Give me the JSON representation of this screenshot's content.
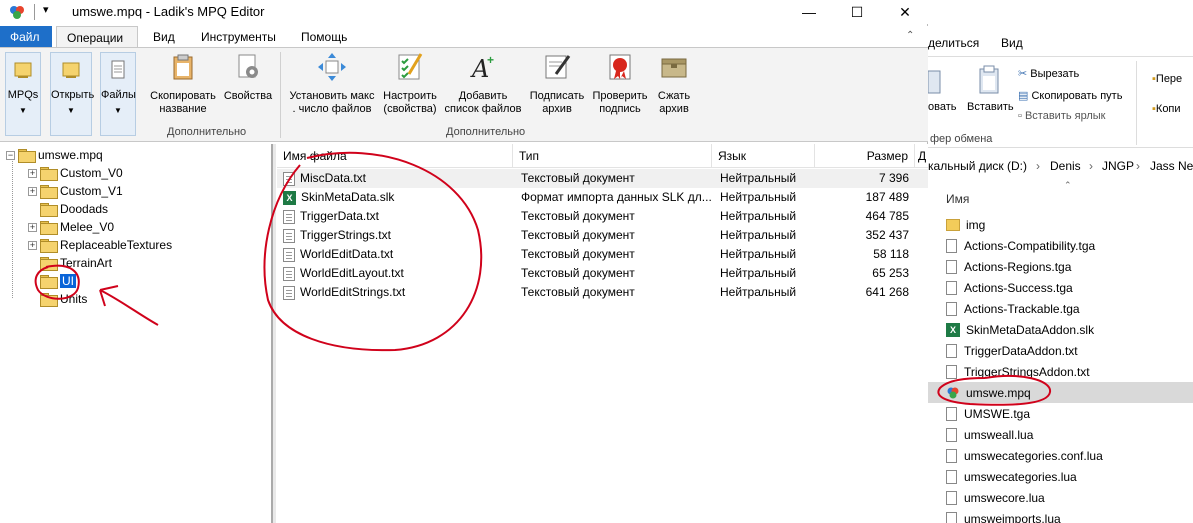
{
  "window": {
    "title": "umswe.mpq - Ladik's MPQ Editor",
    "qat_arrow": "▾",
    "minimize": "—",
    "maximize": "☐",
    "close": "✕"
  },
  "ribbon": {
    "tabs": [
      "Файл",
      "Операции",
      "Вид",
      "Инструменты",
      "Помощь"
    ],
    "buttons": {
      "mpqs": "MPQs",
      "open": "Открыть",
      "files": "Файлы",
      "copy_name": [
        "Скопировать",
        "название"
      ],
      "properties": "Свойства",
      "set_max": [
        "Установить макс",
        ". число файлов"
      ],
      "settings": [
        "Настроить",
        "(свойства)"
      ],
      "add_list": [
        "Добавить",
        "список файлов"
      ],
      "sign": [
        "Подписать",
        "архив"
      ],
      "verify": [
        "Проверить",
        "подпись"
      ],
      "compress": [
        "Сжать",
        "архив"
      ]
    },
    "groups": [
      "Дополнительно",
      "Дополнительно"
    ],
    "collapse": "⌃"
  },
  "tree": {
    "root": "umswe.mpq",
    "items": [
      {
        "label": "Custom_V0",
        "expandable": true
      },
      {
        "label": "Custom_V1",
        "expandable": true
      },
      {
        "label": "Doodads",
        "expandable": false
      },
      {
        "label": "Melee_V0",
        "expandable": true
      },
      {
        "label": "ReplaceableTextures",
        "expandable": true
      },
      {
        "label": "TerrainArt",
        "expandable": false
      },
      {
        "label": "UI",
        "expandable": false,
        "selected": true
      },
      {
        "label": "Units",
        "expandable": false
      }
    ]
  },
  "list": {
    "columns": [
      "Имя файла",
      "Тип",
      "Язык",
      "Размер",
      "Д"
    ],
    "rows": [
      {
        "name": "MiscData.txt",
        "type": "Текстовый документ",
        "lang": "Нейтральный",
        "size": "7 396",
        "icon": "text"
      },
      {
        "name": "SkinMetaData.slk",
        "type": "Формат импорта данных SLK дл...",
        "lang": "Нейтральный",
        "size": "187 489",
        "icon": "excel"
      },
      {
        "name": "TriggerData.txt",
        "type": "Текстовый документ",
        "lang": "Нейтральный",
        "size": "464 785",
        "icon": "text"
      },
      {
        "name": "TriggerStrings.txt",
        "type": "Текстовый документ",
        "lang": "Нейтральный",
        "size": "352 437",
        "icon": "text"
      },
      {
        "name": "WorldEditData.txt",
        "type": "Текстовый документ",
        "lang": "Нейтральный",
        "size": "58 118",
        "icon": "text"
      },
      {
        "name": "WorldEditLayout.txt",
        "type": "Текстовый документ",
        "lang": "Нейтральный",
        "size": "65 253",
        "icon": "text"
      },
      {
        "name": "WorldEditStrings.txt",
        "type": "Текстовый документ",
        "lang": "Нейтральный",
        "size": "641 268",
        "icon": "text"
      }
    ]
  },
  "explorer": {
    "tabs": [
      "делиться",
      "Вид"
    ],
    "buttons": {
      "paste": "Вставить",
      "paste_cut": "овать",
      "cut": "Вырезать",
      "copy_path": "Скопировать путь",
      "paste_shortcut": "Вставить ярлык",
      "right1": "Пере",
      "right2": "Копи"
    },
    "group_label": "фер обмена",
    "address": [
      "кальный диск (D:)",
      "Denis",
      "JNGP",
      "Jass Nev"
    ],
    "sep": "›",
    "column": "Имя",
    "sort_arrow": "⌃",
    "items": [
      {
        "name": "img",
        "icon": "folder"
      },
      {
        "name": "Actions-Compatibility.tga",
        "icon": "file"
      },
      {
        "name": "Actions-Regions.tga",
        "icon": "file"
      },
      {
        "name": "Actions-Success.tga",
        "icon": "file"
      },
      {
        "name": "Actions-Trackable.tga",
        "icon": "file"
      },
      {
        "name": "SkinMetaDataAddon.slk",
        "icon": "excel"
      },
      {
        "name": "TriggerDataAddon.txt",
        "icon": "file"
      },
      {
        "name": "TriggerStringsAddon.txt",
        "icon": "file"
      },
      {
        "name": "umswe.mpq",
        "icon": "mpq",
        "selected": true
      },
      {
        "name": "UMSWE.tga",
        "icon": "file"
      },
      {
        "name": "umsweall.lua",
        "icon": "file"
      },
      {
        "name": "umswecategories.conf.lua",
        "icon": "file"
      },
      {
        "name": "umswecategories.lua",
        "icon": "file"
      },
      {
        "name": "umswecore.lua",
        "icon": "file"
      },
      {
        "name": "umsweimports.lua",
        "icon": "file"
      }
    ]
  },
  "colors": {
    "file_tab": "#1e6fc9",
    "selection": "#0a64d8",
    "annotation": "#d0021b"
  }
}
